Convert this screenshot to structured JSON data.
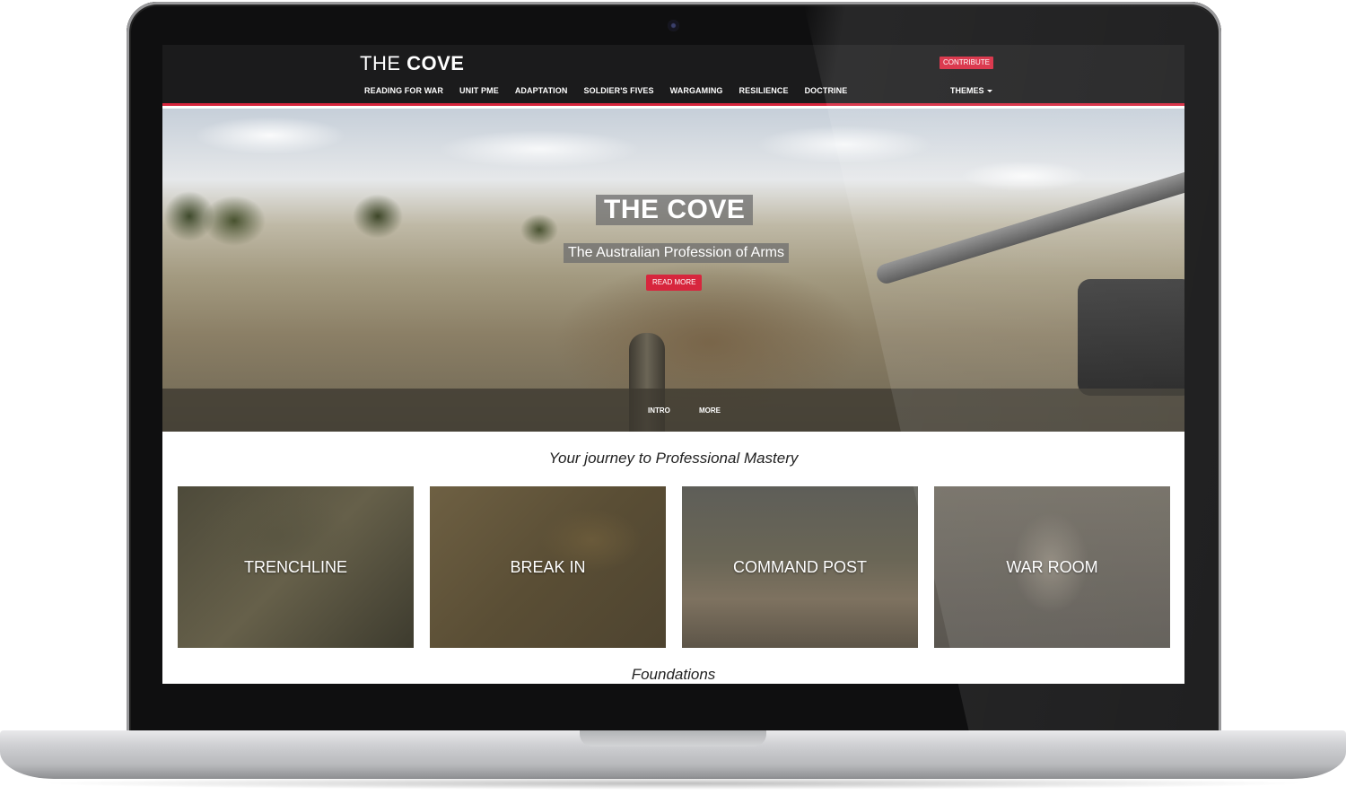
{
  "header": {
    "logo_thin": "THE ",
    "logo_bold": "COVE",
    "contribute_label": "CONTRIBUTE",
    "nav": [
      "READING FOR WAR",
      "UNIT PME",
      "ADAPTATION",
      "SOLDIER'S FIVES",
      "WARGAMING",
      "RESILIENCE",
      "DOCTRINE"
    ],
    "themes_label": "THEMES"
  },
  "hero": {
    "title": "THE COVE",
    "subtitle": "The Australian Profession of Arms",
    "button_label": "READ MORE",
    "tabs": [
      "INTRO",
      "MORE"
    ]
  },
  "journey": {
    "title": "Your journey to Professional Mastery",
    "cards": [
      "TRENCHLINE",
      "BREAK IN",
      "COMMAND POST",
      "WAR ROOM"
    ]
  },
  "foundations": {
    "title": "Foundations"
  },
  "colors": {
    "accent": "#d7263d",
    "header_bg": "#1b1b1c"
  }
}
